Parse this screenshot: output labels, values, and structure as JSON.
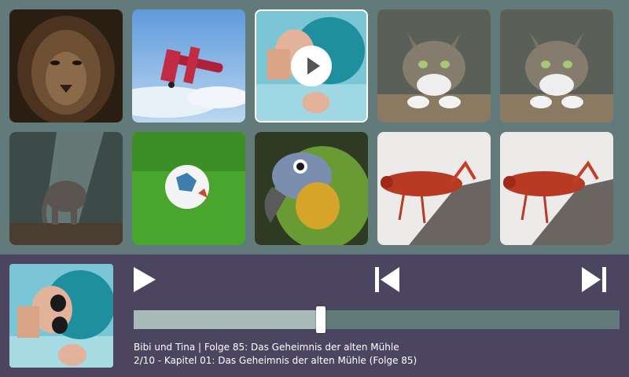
{
  "grid": {
    "tiles": [
      {
        "icon": "lion-image"
      },
      {
        "icon": "biplane-image"
      },
      {
        "icon": "girl-blue-hair-image",
        "state": "playing"
      },
      {
        "icon": "cat-image"
      },
      {
        "icon": "cat-image"
      },
      {
        "icon": "elephant-image"
      },
      {
        "icon": "soccer-ball-image"
      },
      {
        "icon": "parrot-image"
      },
      {
        "icon": "grasshopper-image"
      },
      {
        "icon": "grasshopper-image"
      }
    ]
  },
  "player": {
    "cover_icon": "girl-blue-hair-image",
    "controls": {
      "play": "play-icon",
      "previous": "skip-previous-icon",
      "next": "skip-next-icon"
    },
    "progress": 0.385,
    "title": "Bibi und Tina | Folge 85: Das Geheimnis der alten Mühle",
    "subtitle": "2/10 - Kapitel 01: Das Geheimnis der alten Mühle (Folge 85)"
  },
  "colors": {
    "background": "#627a7a",
    "player_bar": "#4b4560",
    "progress_fill": "#a8bab8",
    "knob": "#ffffff"
  }
}
